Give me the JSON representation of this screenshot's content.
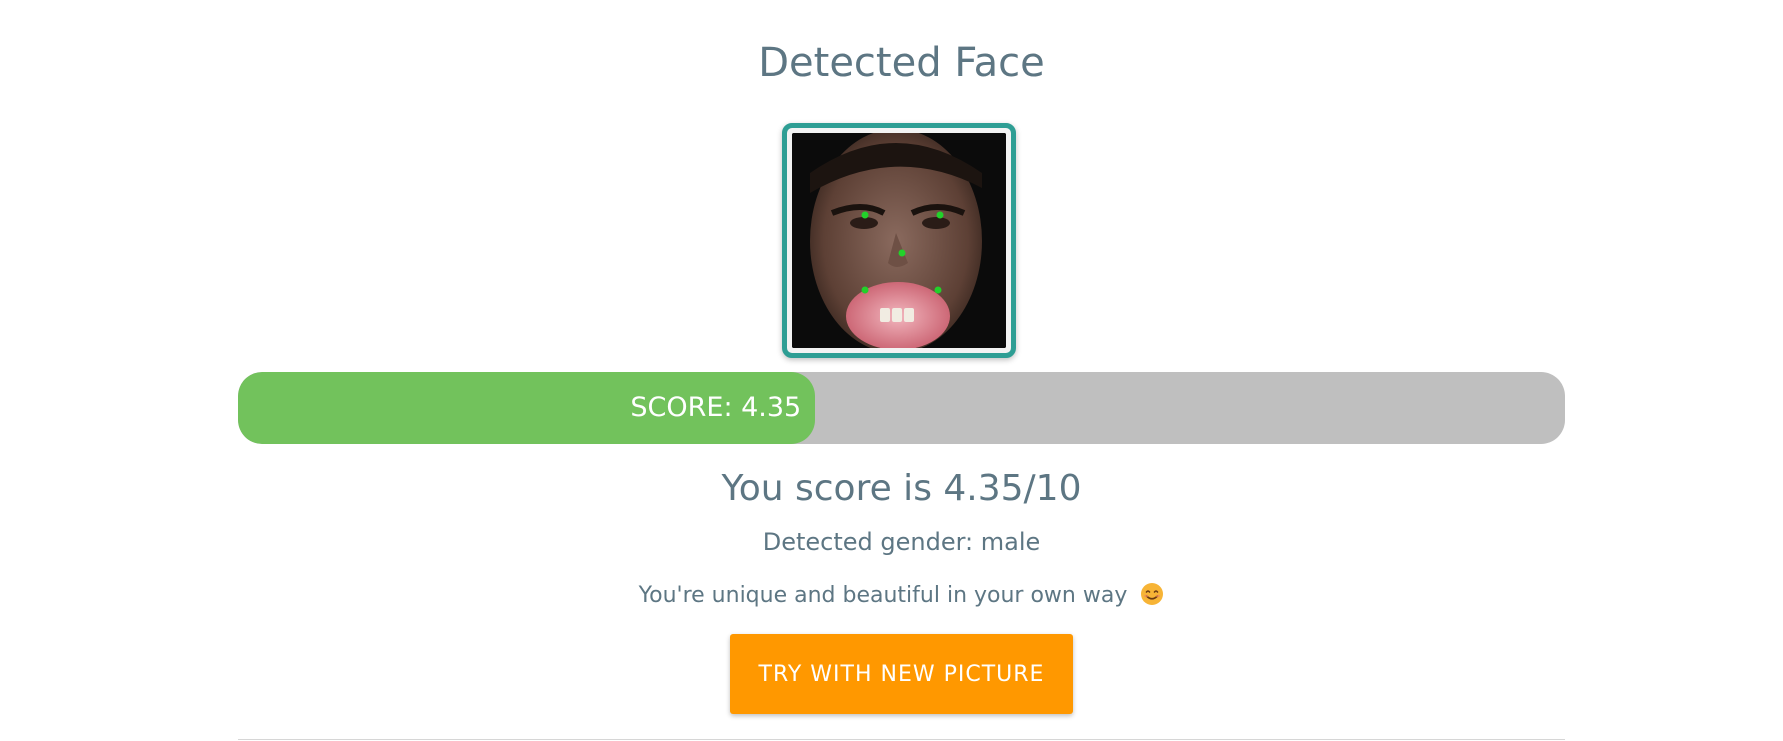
{
  "page": {
    "title": "Detected Face"
  },
  "face": {
    "description_icon": "face-photo-with-landmarks",
    "frame_color": "#2e9e94",
    "landmark_color": "#22d12a"
  },
  "score_bar": {
    "label": "SCORE: 4.35",
    "score": 4.35,
    "max": 10,
    "fill_fraction": 0.435,
    "fill_color": "#72c25c",
    "track_color": "#bfbfbf"
  },
  "result": {
    "score_text": "You score is 4.35/10",
    "gender_text": "Detected gender: male",
    "message_text": "You're unique and beautiful in your own way",
    "emoji_icon": "smiling-face-icon"
  },
  "actions": {
    "try_button_label": "TRY WITH NEW PICTURE",
    "button_color": "#ff9800"
  }
}
